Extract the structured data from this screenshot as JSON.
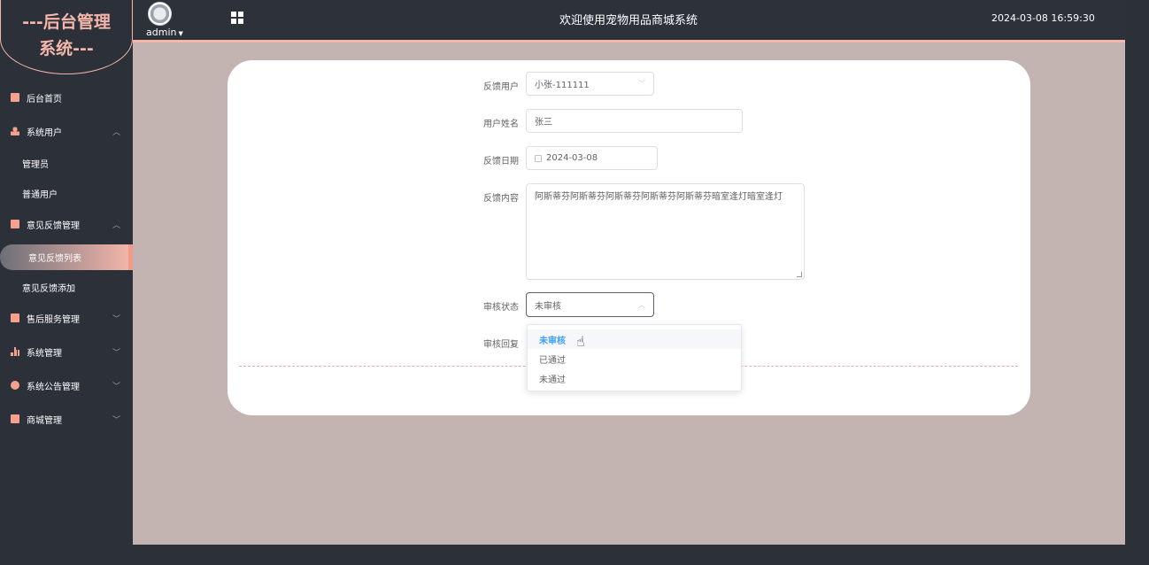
{
  "sidebar": {
    "logo": [
      "---后台管理",
      "系统---"
    ],
    "menu": [
      {
        "label": "后台首页",
        "icon": "monitor-icon"
      },
      {
        "label": "系统用户",
        "icon": "user-icon"
      },
      {
        "label": "意见反馈管理",
        "icon": "chart-icon"
      },
      {
        "label": "售后服务管理",
        "icon": "chart-icon"
      },
      {
        "label": "系统管理",
        "icon": "bar-chart-icon"
      },
      {
        "label": "系统公告管理",
        "icon": "info-icon"
      },
      {
        "label": "商城管理",
        "icon": "monitor-icon"
      }
    ],
    "sub": {
      "admin": "管理员",
      "normal_user": "普通用户",
      "feedback_list": "意见反馈列表",
      "feedback_add": "意见反馈添加"
    }
  },
  "header": {
    "user": "admin",
    "welcome": "欢迎使用宠物用品商城系统",
    "datetime": "2024-03-08 16:59:30"
  },
  "form": {
    "labels": {
      "user": "反馈用户",
      "name": "用户姓名",
      "date": "反馈日期",
      "content": "反馈内容",
      "status": "审核状态",
      "reply": "审核回复"
    },
    "values": {
      "user": "小张-111111",
      "name": "张三",
      "date": "2024-03-08",
      "content": "阿斯蒂芬阿斯蒂芬阿斯蒂芬阿斯蒂芬阿斯蒂芬暗室逢灯暗室逢灯",
      "status": "未审核"
    }
  },
  "dropdown": {
    "options": [
      "未审核",
      "已通过",
      "未通过"
    ],
    "selected": "未审核"
  },
  "colors": {
    "accent": "#f6b7ab",
    "sidebar": "#2c3039",
    "main_bg": "#c3b4b2",
    "select_blue": "#409eff"
  }
}
